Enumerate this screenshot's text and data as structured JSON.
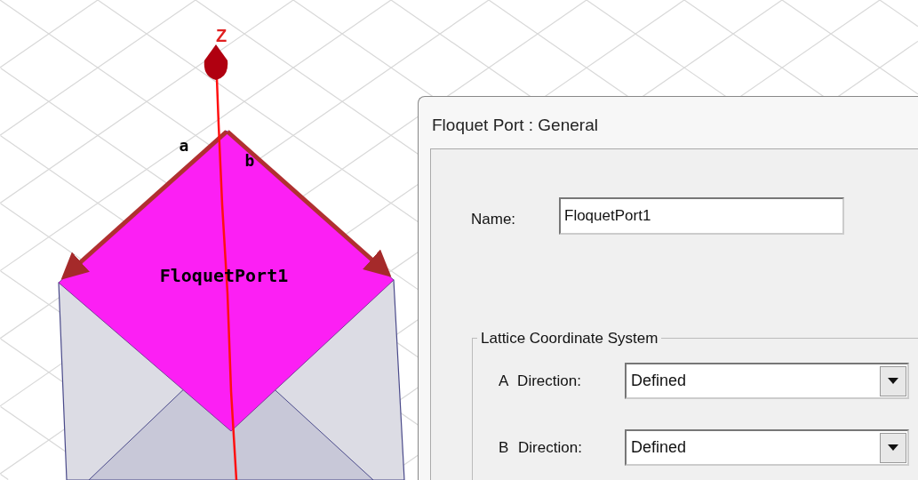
{
  "viewport": {
    "axis_label": "Z",
    "vector_labels": [
      "a",
      "b"
    ],
    "port_label": "FloquetPort1"
  },
  "dialog": {
    "title": "Floquet Port : General",
    "name_label": "Name:",
    "name_value": "FloquetPort1",
    "group": {
      "title": "Lattice Coordinate System",
      "rows": [
        {
          "label": "A Direction:",
          "value": "Defined"
        },
        {
          "label": "B Direction:",
          "value": "Defined"
        }
      ]
    }
  }
}
